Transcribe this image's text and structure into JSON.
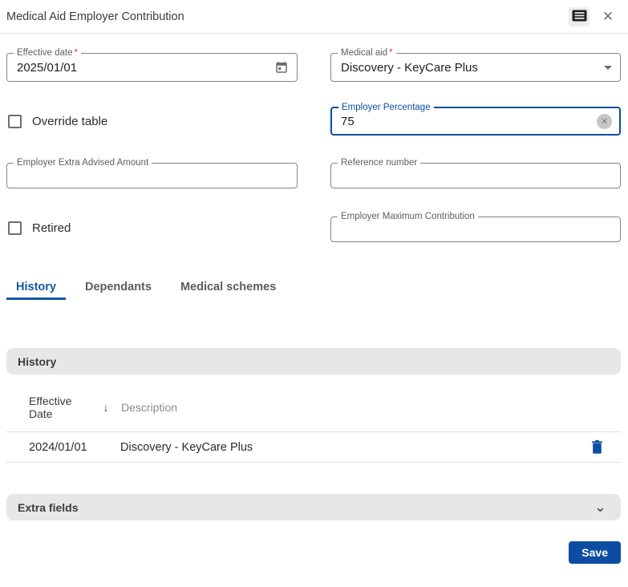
{
  "dialog": {
    "title": "Medical Aid Employer Contribution"
  },
  "required_marker": "*",
  "icons": {
    "close": "✕",
    "sort_desc": "↓",
    "chevron_down": "⌄",
    "clear": "✕"
  },
  "form": {
    "effective_date": {
      "label": "Effective date",
      "required": true,
      "value": "2025/01/01"
    },
    "medical_aid": {
      "label": "Medical aid",
      "required": true,
      "value": "Discovery - KeyCare Plus"
    },
    "override_table": {
      "label": "Override table",
      "checked": false
    },
    "employer_percentage": {
      "label": "Employer Percentage",
      "value": "75",
      "focused": true
    },
    "employer_extra_advised_amount": {
      "label": "Employer Extra Advised Amount",
      "value": ""
    },
    "reference_number": {
      "label": "Reference number",
      "value": ""
    },
    "retired": {
      "label": "Retired",
      "checked": false
    },
    "employer_maximum_contribution": {
      "label": "Employer Maximum Contribution",
      "value": ""
    }
  },
  "tabs": [
    {
      "label": "History",
      "active": true
    },
    {
      "label": "Dependants",
      "active": false
    },
    {
      "label": "Medical schemes",
      "active": false
    }
  ],
  "history": {
    "section_title": "History",
    "table": {
      "col_effective_date": "Effective Date",
      "col_description": "Description",
      "sort": {
        "column": "Effective Date",
        "direction": "desc"
      },
      "rows": [
        {
          "effective_date": "2024/01/01",
          "description": "Discovery - KeyCare Plus"
        }
      ]
    }
  },
  "extra_fields": {
    "label": "Extra fields",
    "collapsed": true
  },
  "actions": {
    "save": "Save"
  },
  "colors": {
    "accent_blue": "#0c4da2",
    "tab_active_blue": "#1256a3",
    "save_button_bg": "#0c4da2",
    "delete_icon_blue": "#0c4da2",
    "required_red": "#e53935",
    "section_bar_gray": "#e7e7e7",
    "field_border_gray": "#838383"
  }
}
